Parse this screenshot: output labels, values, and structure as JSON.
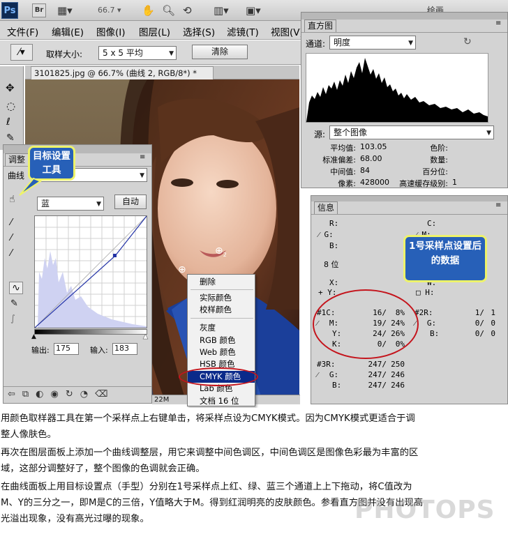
{
  "app": {
    "logo": "Ps",
    "bridge": "Br",
    "zoom": "66.7",
    "workspace": "绘画"
  },
  "menu": [
    "文件(F)",
    "编辑(E)",
    "图像(I)",
    "图层(L)",
    "选择(S)",
    "滤镜(T)",
    "视图(V)"
  ],
  "options": {
    "sample_label": "取样大小:",
    "sample_value": "5 x 5 平均",
    "clear_button": "清除"
  },
  "document": {
    "tab": "3101825.jpg @ 66.7% (曲线 2, RGB/8*) *",
    "status": "22M"
  },
  "adjust": {
    "tab": "调整",
    "curve_label": "曲线",
    "preset": "自定",
    "channel": "蓝",
    "auto_button": "自动",
    "output_label": "输出:",
    "output_value": "175",
    "input_label": "输入:",
    "input_value": "183",
    "tooltip": "目标设置工具"
  },
  "histogram": {
    "tab": "直方图",
    "channel_label": "通道:",
    "channel": "明度",
    "source_label": "源:",
    "source": "整个图像",
    "stats": [
      {
        "k": "平均值:",
        "v": "103.05"
      },
      {
        "k": "标准偏差:",
        "v": "68.00"
      },
      {
        "k": "中间值:",
        "v": "84"
      },
      {
        "k": "像素:",
        "v": "428000"
      }
    ],
    "stats2": [
      {
        "k": "色阶:",
        "v": ""
      },
      {
        "k": "数量:",
        "v": ""
      },
      {
        "k": "百分位:",
        "v": ""
      },
      {
        "k": "高速缓存级别:",
        "v": "1"
      }
    ]
  },
  "info": {
    "tab": "信息",
    "r": "R:",
    "g": "G:",
    "b": "B:",
    "c": "C:",
    "m": "M:",
    "bitdepth": "8 位",
    "x": "X:",
    "y": "Y:",
    "w": "W:",
    "h": "H:",
    "s1": {
      "id": "#1",
      "rows": [
        {
          "k": "C:",
          "a": "16/",
          "b": "8%"
        },
        {
          "k": "M:",
          "a": "19/",
          "b": "24%"
        },
        {
          "k": "Y:",
          "a": "24/",
          "b": "26%"
        },
        {
          "k": "K:",
          "a": "0/",
          "b": "0%"
        }
      ]
    },
    "s2": {
      "id": "#2",
      "rows": [
        {
          "k": "R:",
          "a": "1/",
          "b": "1"
        },
        {
          "k": "G:",
          "a": "0/",
          "b": "0"
        },
        {
          "k": "B:",
          "a": "0/",
          "b": "0"
        }
      ]
    },
    "s3": {
      "id": "#3",
      "rows": [
        {
          "k": "R:",
          "a": "247/",
          "b": "250"
        },
        {
          "k": "G:",
          "a": "247/",
          "b": "246"
        },
        {
          "k": "B:",
          "a": "247/",
          "b": "246"
        }
      ]
    },
    "tooltip": "1号采样点设置后的数据"
  },
  "context_menu": [
    "删除",
    "实际颜色",
    "校样颜色",
    "灰度",
    "RGB 颜色",
    "Web 颜色",
    "HSB 颜色",
    "CMYK 颜色",
    "Lab 颜色",
    "文档 16 位"
  ],
  "caption": [
    "用颜色取样器工具在第一个采样点上右键单击，将采样点设为CMYK模式。因为CMYK模式更适合于调",
    "整人像肤色。",
    "再次在图层面板上添加一个曲线调整层，用它来调整中间色调区，中间色调区是图像色彩最为丰富的区",
    "域，这部分调整好了，整个图像的色调就会正确。",
    "在曲线面板上用目标设置点（手型）分别在1号采样点上红、绿、蓝三个通道上上下拖动，将C值改为",
    "M、Y的三分之一，即M是C的三倍，Y值略大于M。得到红润明亮的皮肤颜色。参看直方图并没有出现高",
    "光溢出现象，没有高光过曝的现象。"
  ],
  "watermark": "PHOTOPS"
}
